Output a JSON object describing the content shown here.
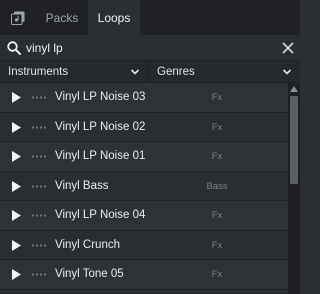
{
  "tabs": {
    "icon": "library-icon",
    "items": [
      {
        "label": "Packs",
        "active": false
      },
      {
        "label": "Loops",
        "active": true
      }
    ]
  },
  "search": {
    "value": "vinyl lp",
    "placeholder": "",
    "icon": "search-icon",
    "clear_icon": "close-icon"
  },
  "filters": {
    "instruments_label": "Instruments",
    "genres_label": "Genres"
  },
  "loops": [
    {
      "name": "Vinyl LP Noise 03",
      "genre": "Fx"
    },
    {
      "name": "Vinyl LP Noise 02",
      "genre": "Fx"
    },
    {
      "name": "Vinyl LP Noise 01",
      "genre": "Fx"
    },
    {
      "name": "Vinyl Bass",
      "genre": "Bass"
    },
    {
      "name": "Vinyl LP Noise 04",
      "genre": "Fx"
    },
    {
      "name": "Vinyl Crunch",
      "genre": "Fx"
    },
    {
      "name": "Vinyl Tone 05",
      "genre": "Fx"
    }
  ],
  "colors": {
    "background": "#2b2e32",
    "tabbar": "#1f2124",
    "text": "#eceef0",
    "muted": "#7d8288",
    "scroll_thumb": "#5b6066"
  }
}
